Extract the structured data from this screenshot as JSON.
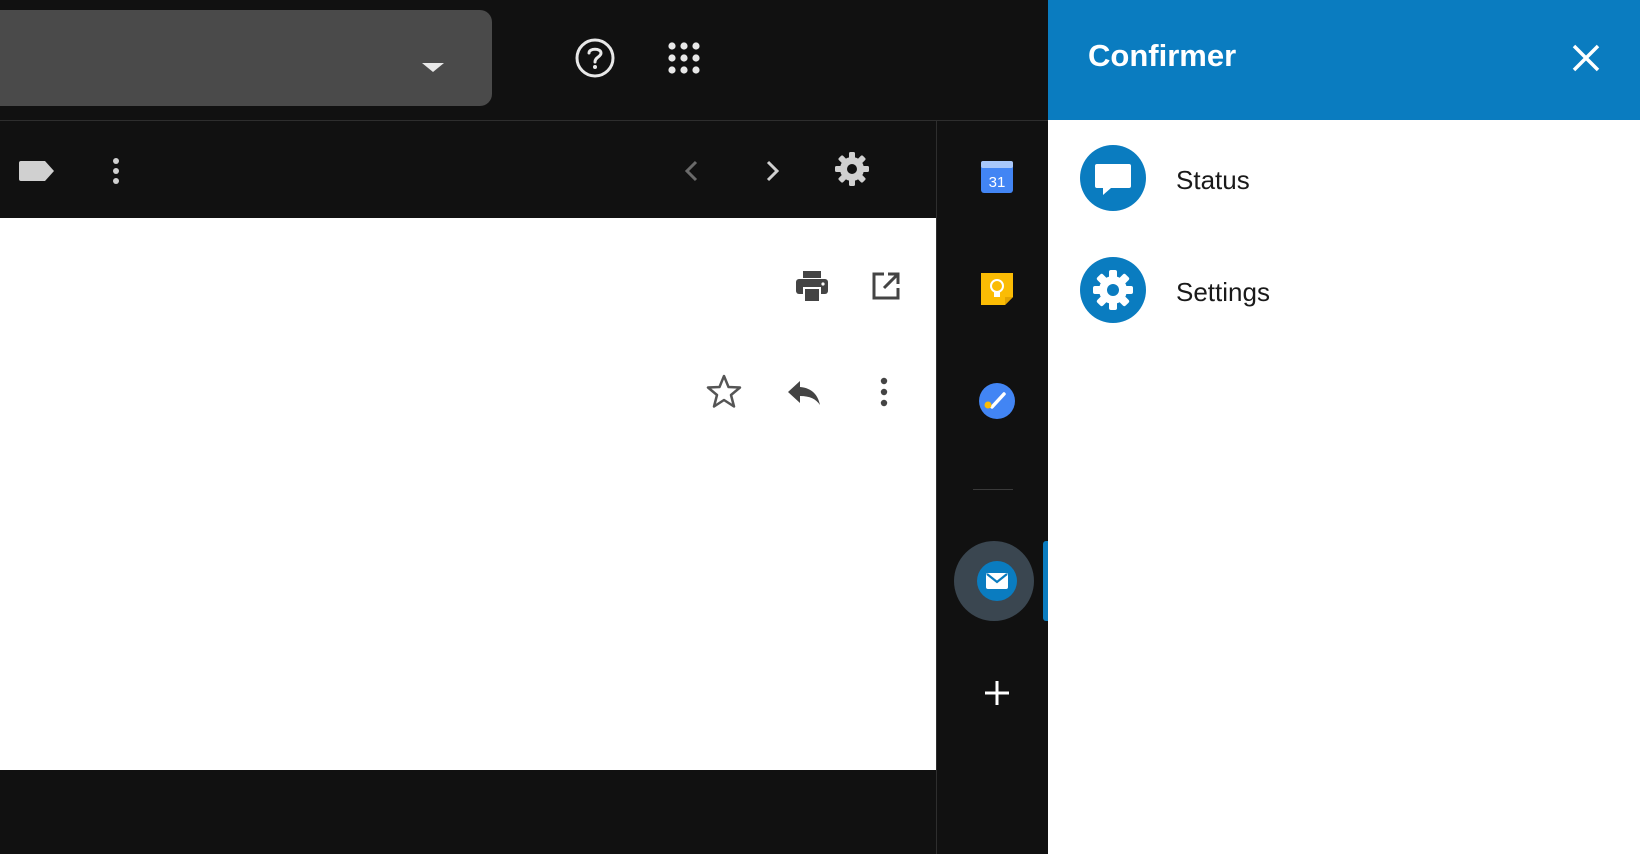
{
  "topbar": {
    "help_icon": "help-circle-icon",
    "apps_icon": "apps-grid-icon"
  },
  "toolbar": {
    "label_icon": "label-icon",
    "more_icon": "more-vert-icon",
    "prev_icon": "chevron-left-icon",
    "next_icon": "chevron-right-icon",
    "settings_icon": "gear-icon"
  },
  "message": {
    "print_icon": "print-icon",
    "open_new_window_icon": "open-in-new-icon",
    "star_icon": "star-outline-icon",
    "reply_icon": "reply-icon",
    "more_icon": "more-vert-icon"
  },
  "rail": {
    "calendar_day": "31",
    "items": [
      "calendar-icon",
      "keep-icon",
      "tasks-icon",
      "confirmer-mail-icon",
      "add-icon"
    ]
  },
  "panel": {
    "title": "Confirmer",
    "close_icon": "close-icon",
    "items": [
      {
        "label": "Status",
        "icon": "chat-bubble-icon"
      },
      {
        "label": "Settings",
        "icon": "gear-icon"
      }
    ]
  },
  "colors": {
    "accent": "#0a7cc0",
    "dark_bg": "#111111",
    "search_bg": "#4a4a4a"
  }
}
